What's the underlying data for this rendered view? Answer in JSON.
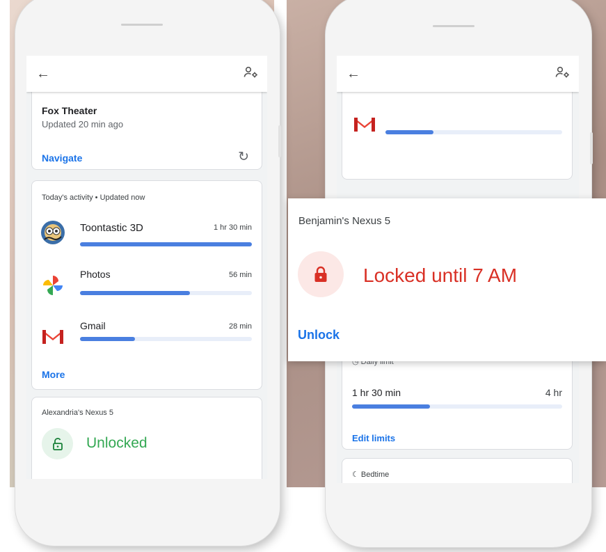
{
  "left_phone": {
    "place_card": {
      "title": "Fox Theater",
      "subtitle": "Updated 20 min ago",
      "navigate_label": "Navigate",
      "refresh_icon": "refresh-icon"
    },
    "activity": {
      "header": "Today's activity • Updated now",
      "apps": [
        {
          "name": "Toontastic 3D",
          "time": "1 hr 30 min",
          "progress": 1.0,
          "icon": "toontastic-icon"
        },
        {
          "name": "Photos",
          "time": "56 min",
          "progress": 0.64,
          "icon": "photos-icon"
        },
        {
          "name": "Gmail",
          "time": "28 min",
          "progress": 0.32,
          "icon": "gmail-icon"
        }
      ],
      "more_label": "More"
    },
    "device_card": {
      "name": "Alexandria's Nexus 5",
      "status": "Unlocked",
      "status_color": "#34a853",
      "icon": "unlocked-icon"
    }
  },
  "right_phone": {
    "gmail_card": {
      "icon": "gmail-icon",
      "progress": 0.27
    },
    "limit_card": {
      "label": "Daily limit",
      "used": "1 hr 30 min",
      "max": "4 hr",
      "progress": 0.37,
      "edit_label": "Edit limits"
    },
    "bedtime_card": {
      "label": "Bedtime"
    }
  },
  "overlay": {
    "device_name": "Benjamin's Nexus 5",
    "status": "Locked until 7 AM",
    "status_color": "#d93025",
    "unlock_label": "Unlock",
    "icon": "lock-icon"
  },
  "colors": {
    "accent": "#1a73e8",
    "progress": "#4a7fe0",
    "locked": "#d93025",
    "unlocked": "#34a853"
  }
}
